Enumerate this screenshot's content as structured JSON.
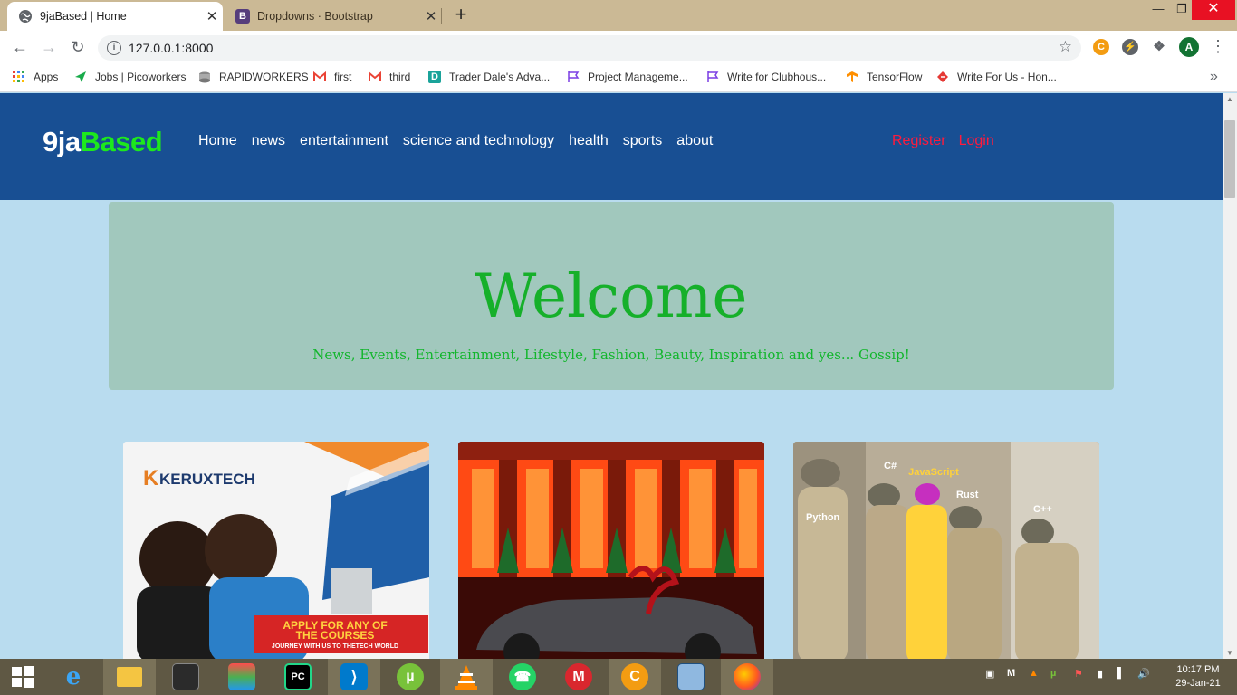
{
  "browser": {
    "tabs": [
      {
        "title": "9jaBased | Home",
        "active": true,
        "favicon": "globe-icon"
      },
      {
        "title": "Dropdowns · Bootstrap",
        "active": false,
        "favicon": "bootstrap-b-icon"
      }
    ],
    "url": "127.0.0.1:8000",
    "profile_initial": "A",
    "bookmarks": [
      {
        "label": "Apps",
        "icon": "apps-grid-icon"
      },
      {
        "label": "Jobs | Picoworkers",
        "icon": "paper-plane-icon"
      },
      {
        "label": "RAPIDWORKERS",
        "icon": "rapidworkers-icon"
      },
      {
        "label": "first",
        "icon": "gmail-icon"
      },
      {
        "label": "third",
        "icon": "gmail-icon"
      },
      {
        "label": "Trader Dale's Adva...",
        "icon": "d-badge-icon"
      },
      {
        "label": "Project Manageme...",
        "icon": "flag-icon"
      },
      {
        "label": "Write for Clubhous...",
        "icon": "flag-icon"
      },
      {
        "label": "TensorFlow",
        "icon": "tensorflow-icon"
      },
      {
        "label": "Write For Us - Hon...",
        "icon": "bookmark-site-icon"
      }
    ]
  },
  "site": {
    "brand_part1": "9ja",
    "brand_part2": "Based",
    "nav": [
      "Home",
      "news",
      "entertainment",
      "science and technology",
      "health",
      "sports",
      "about"
    ],
    "auth": [
      "Register",
      "Login"
    ],
    "hero_title": "Welcome",
    "hero_subtitle": "News, Events, Entertainment, Lifestyle, Fashion, Beauty, Inspiration and yes... Gossip!",
    "cards": [
      {
        "brand": "KERUXTECH",
        "banner_line1": "APPLY FOR ANY OF",
        "banner_line2": "THE COURSES",
        "banner_line3": "JOURNEY WITH US TO THETECH WORLD"
      },
      {
        "description": "luxury car with red bow in front of festive building"
      },
      {
        "labels": [
          "C#",
          "JavaScript",
          "Python",
          "Rust",
          "C++"
        ]
      }
    ]
  },
  "taskbar": {
    "time": "10:17 PM",
    "date": "29-Jan-21"
  },
  "colors": {
    "nav_bg": "#184f93",
    "brand_green": "#1de91d",
    "auth_red": "#ff1a3d",
    "page_bg": "#b9dcef",
    "hero_bg": "#a1c8bd",
    "hero_text": "#16b02a"
  }
}
